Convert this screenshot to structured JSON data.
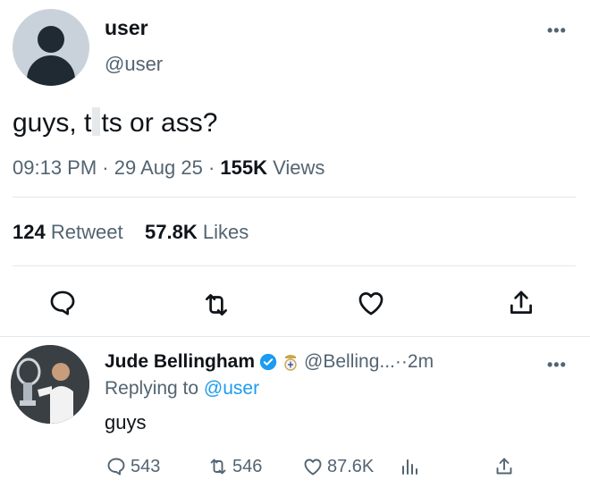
{
  "tweet": {
    "display_name": "user",
    "handle": "@user",
    "text_part1": "guys, t",
    "text_part2": "ts or ass?",
    "time": "09:13 PM",
    "sep1": " · ",
    "date": "29 Aug 25",
    "sep2": " · ",
    "views_count": "155K",
    "views_label": " Views",
    "retweet_count": "124",
    "retweet_label": "Retweet",
    "likes_count": "57.8K",
    "likes_label": "Likes",
    "more": "•••"
  },
  "reply": {
    "display_name": "Jude Bellingham",
    "handle": "@Belling...",
    "time_sep": " ·· ",
    "time": "2m",
    "replying_prefix": "Replying to ",
    "replying_to": "@user",
    "text": "guys",
    "replies": "543",
    "retweets": "546",
    "likes": "87.6K",
    "more": "•••"
  },
  "icons": {
    "reply": "speech-bubble-icon",
    "retweet": "retweet-arrows-icon",
    "like": "heart-icon",
    "share": "share-upload-icon",
    "views": "bar-chart-icon",
    "verified": "verified-badge-icon",
    "club": "club-crest-icon"
  },
  "colors": {
    "accent": "#1d9bf0",
    "text_primary": "#0f1419",
    "text_secondary": "#536471"
  }
}
